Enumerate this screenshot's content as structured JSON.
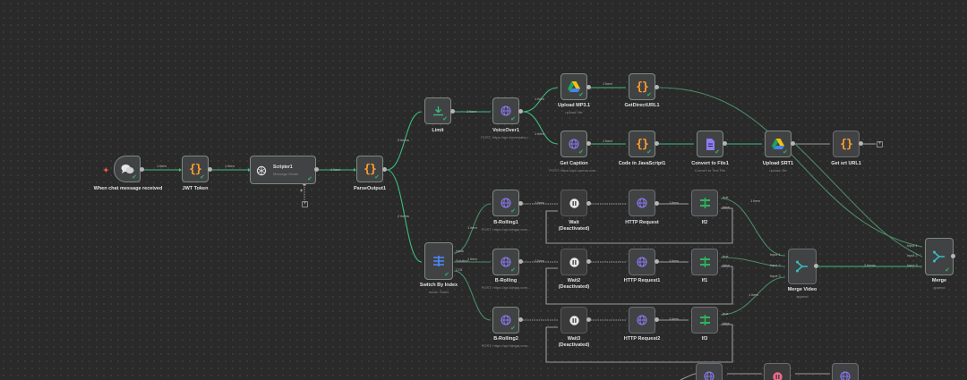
{
  "nodes": {
    "chat": {
      "label": "When chat message received",
      "icon": "chat-bubbles-icon"
    },
    "jwt": {
      "label": "JWT Token",
      "icon": "code-braces-icon"
    },
    "scripter": {
      "label": "Scripter1",
      "sub": "Message Model",
      "icon": "openai-icon"
    },
    "parse": {
      "label": "ParseOutput1",
      "icon": "code-braces-icon"
    },
    "limit": {
      "label": "Limit",
      "icon": "limit-icon"
    },
    "voice": {
      "label": "VoiceOver1",
      "sub": "POST: https://api.elevenlabs.i...",
      "icon": "globe-icon"
    },
    "uploadmp3": {
      "label": "Upload MP3.1",
      "sub": "upload: file",
      "icon": "google-drive-icon"
    },
    "getdirect": {
      "label": "GetDirectURL1",
      "icon": "code-braces-icon"
    },
    "caption": {
      "label": "Get Caption",
      "sub": "POST: https://api.openai.com...",
      "icon": "globe-icon"
    },
    "codejs": {
      "label": "Code in JavaScript1",
      "icon": "code-braces-icon"
    },
    "convert": {
      "label": "Convert to File1",
      "sub": "Convert to Text File",
      "icon": "file-convert-icon"
    },
    "uploadsrt": {
      "label": "Upload SRT1",
      "sub": "upload: file",
      "icon": "google-drive-icon"
    },
    "geturl": {
      "label": "Get srt URL1",
      "icon": "code-braces-icon"
    },
    "switch": {
      "label": "Switch By Index",
      "sub": "mode: Rules",
      "icon": "switch-icon"
    },
    "broll1": {
      "label": "B-Rolling1",
      "sub": "POST: https://api.klingai.com...",
      "icon": "globe-icon"
    },
    "broll": {
      "label": "B-Rolling",
      "sub": "POST: https://api.klingai.com...",
      "icon": "globe-icon"
    },
    "broll2": {
      "label": "B-Rolling2",
      "sub": "POST: https://api.klingai.com...",
      "icon": "globe-icon"
    },
    "wait": {
      "label": "Wait",
      "sub2": "(Deactivated)",
      "icon": "pause-icon"
    },
    "wait2": {
      "label": "Wait2",
      "sub2": "(Deactivated)",
      "icon": "pause-icon"
    },
    "wait3": {
      "label": "Wait3",
      "sub2": "(Deactivated)",
      "icon": "pause-icon"
    },
    "http": {
      "label": "HTTP Request",
      "icon": "globe-icon"
    },
    "http1": {
      "label": "HTTP Request1",
      "icon": "globe-icon"
    },
    "http2": {
      "label": "HTTP Request2",
      "icon": "globe-icon"
    },
    "if2": {
      "label": "If2",
      "icon": "if-icon"
    },
    "if1": {
      "label": "If1",
      "icon": "if-icon"
    },
    "if3": {
      "label": "If3",
      "icon": "if-icon"
    },
    "mergevideo": {
      "label": "Merge Video",
      "sub": "append",
      "icon": "merge-icon"
    },
    "merge": {
      "label": "Merge",
      "sub": "append",
      "icon": "merge-icon"
    }
  },
  "edge_labels": {
    "one_item": "1 item",
    "two_items": "2 items",
    "three_items": "3 items"
  },
  "ports": {
    "true": "true",
    "false": "false",
    "hook": "Hook",
    "solution": "Solution",
    "cta": "CTA",
    "input1": "Input 1",
    "input2": "Input 2",
    "input3": "Input 3"
  },
  "colors": {
    "edge": "#4a8a66",
    "edge_active": "#3dbd7d",
    "edge_idle": "#9a9a9a",
    "node_bg": "#414244",
    "node_border": "#6b6d70",
    "braces": "#ff9d2d",
    "globe": "#8d7cf5",
    "if_green": "#2fb45e",
    "switch_blue": "#4d88ff",
    "merge_teal": "#36bfc0",
    "trigger_accent": "#ff5a44"
  }
}
